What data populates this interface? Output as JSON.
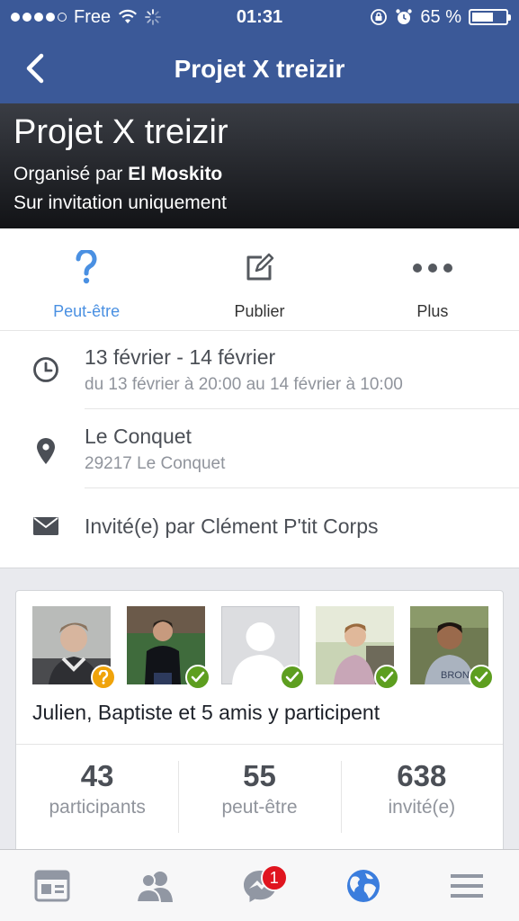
{
  "status_bar": {
    "carrier": "Free",
    "time": "01:31",
    "battery": "65 %",
    "battery_level": 0.65
  },
  "nav": {
    "title": "Projet X treizir"
  },
  "event": {
    "title": "Projet X treizir",
    "organizer_prefix": "Organisé par",
    "organizer_name": "El Moskito",
    "privacy": "Sur invitation uniquement"
  },
  "actions": [
    {
      "label": "Peut-être",
      "icon": "question-mark-icon",
      "active": true
    },
    {
      "label": "Publier",
      "icon": "compose-icon",
      "active": false
    },
    {
      "label": "Plus",
      "icon": "more-dots-icon",
      "active": false
    }
  ],
  "details": {
    "date_main": "13 février - 14 février",
    "date_sub": "du 13 février à 20:00 au 14 février à 10:00",
    "location_main": "Le Conquet",
    "location_sub": "29217 Le Conquet",
    "invited_by": "Invité(e) par Clément P'tit Corps"
  },
  "friends": {
    "avatars": [
      {
        "status": "maybe"
      },
      {
        "status": "going"
      },
      {
        "status": "going"
      },
      {
        "status": "going"
      },
      {
        "status": "going"
      }
    ],
    "summary": "Julien, Baptiste et 5 amis y participent"
  },
  "stats": [
    {
      "number": "43",
      "label": "participants"
    },
    {
      "number": "55",
      "label": "peut-être"
    },
    {
      "number": "638",
      "label": "invité(e)"
    }
  ],
  "tabbar": {
    "tabs": [
      "news-feed-icon",
      "friends-icon",
      "messenger-icon",
      "globe-icon",
      "menu-icon"
    ],
    "messenger_badge": "1"
  },
  "colors": {
    "brand": "#3b5998",
    "active_blue": "#4a90e2",
    "going_green": "#5d9e1f",
    "maybe_orange": "#f0a30a",
    "badge_red": "#e0151f"
  }
}
